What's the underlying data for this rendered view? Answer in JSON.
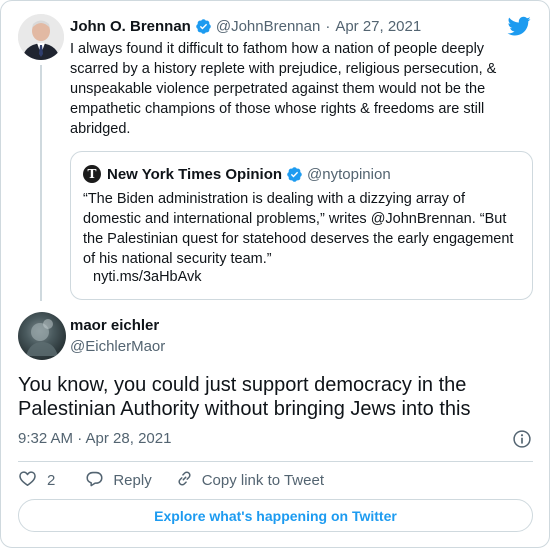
{
  "parent_tweet": {
    "author_name": "John O. Brennan",
    "author_handle": "@JohnBrennan",
    "separator": "·",
    "date": "Apr 27, 2021",
    "text": "I always found it difficult to fathom how a nation of people deeply scarred by a history replete with prejudice, religious persecution, & unspeakable violence perpetrated against them would not be the empathetic champions of those whose rights & freedoms are still abridged."
  },
  "quoted_tweet": {
    "avatar_letter": "T",
    "author_name": "New York Times Opinion",
    "author_handle": "@nytopinion",
    "text": "“The Biden administration is dealing with a dizzying array of domestic and international problems,” writes @JohnBrennan. “But the Palestinian quest for statehood deserves the early engagement of his national security team.”",
    "link": "nyti.ms/3aHbAvk"
  },
  "reply_tweet": {
    "author_name": "maor eichler",
    "author_handle": "@EichlerMaor",
    "text": "You know, you could just support democracy in the Palestinian Authority without bringing Jews into this",
    "timestamp": "9:32 AM · Apr 28, 2021"
  },
  "actions": {
    "like_count": "2",
    "reply_label": "Reply",
    "copy_link_label": "Copy link to Tweet"
  },
  "explore_button": "Explore what's happening on Twitter",
  "icons": {
    "brand": "twitter-bird-icon",
    "verified": "verified-badge-icon",
    "info": "info-icon",
    "like": "heart-icon",
    "reply": "speech-bubble-icon",
    "copy": "link-icon"
  },
  "colors": {
    "accent": "#1d9bf0",
    "text": "#0f1419",
    "muted": "#536471",
    "border": "#cfd9de"
  }
}
